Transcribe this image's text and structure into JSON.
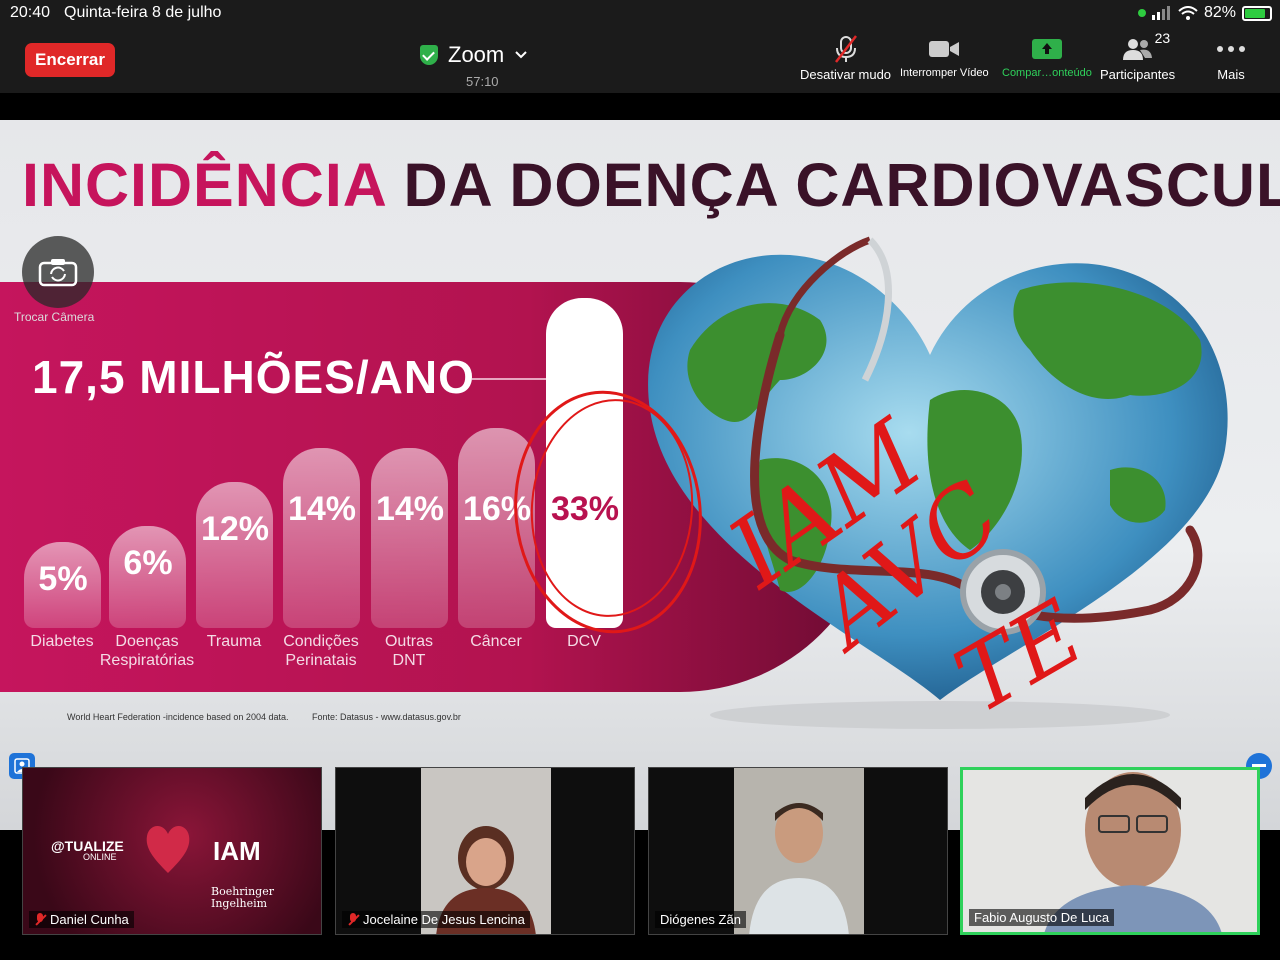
{
  "status_bar": {
    "time": "20:40",
    "date": "Quinta-feira 8 de julho",
    "battery_percent_label": "82%",
    "battery_level": 0.82
  },
  "toolbar": {
    "end_label": "Encerrar",
    "app_name": "Zoom",
    "timer": "57:10",
    "mute_label": "Desativar mudo",
    "video_label": "Interromper Vídeo",
    "share_label": "Compar…onteúdo",
    "participants_label": "Participantes",
    "participants_count": "23",
    "more_label": "Mais"
  },
  "slide": {
    "title_part1": "INCIDÊNCIA",
    "title_part2": "DA DOENÇA CARDIOVASCULAR",
    "headline": "17,5 MILHÕES/ANO",
    "camera_label": "Trocar Câmera",
    "source_left": "World Heart Federation -incidence based on 2004 data.",
    "source_right": "Fonte: Datasus - www.datasus.gov.br",
    "handwritten": [
      "IAM",
      "AVC",
      "TE"
    ]
  },
  "chart_data": {
    "type": "bar",
    "title": "",
    "categories": [
      "Diabetes",
      "Doenças Respiratórias",
      "Trauma",
      "Condições Perinatais",
      "Outras DNT",
      "Câncer",
      "DCV"
    ],
    "category_lines": [
      [
        "Diabetes"
      ],
      [
        "Doenças",
        "Respiratórias"
      ],
      [
        "Trauma"
      ],
      [
        "Condições",
        "Perinatais"
      ],
      [
        "Outras",
        "DNT"
      ],
      [
        "Câncer"
      ],
      [
        "DCV"
      ]
    ],
    "values": [
      5,
      6,
      12,
      14,
      14,
      16,
      33
    ],
    "value_labels": [
      "5%",
      "6%",
      "12%",
      "14%",
      "14%",
      "16%",
      "33%"
    ],
    "unit": "%",
    "highlight": "DCV",
    "colors": {
      "band": "#c5155d",
      "highlight_bar": "#ffffff",
      "highlight_text": "#b8124f"
    }
  },
  "participants": [
    {
      "name": "Daniel Cunha",
      "muted": true,
      "content": {
        "brand": "@TUALIZE",
        "brand_sub": "ONLINE",
        "topic": "IAM",
        "sponsor": "Boehringer Ingelheim"
      }
    },
    {
      "name": "Jocelaine De Jesus Lencina",
      "muted": true
    },
    {
      "name": "Diógenes Zãn",
      "muted": false
    },
    {
      "name": "Fabio Augusto De Luca",
      "muted": false,
      "active_speaker": true
    }
  ]
}
